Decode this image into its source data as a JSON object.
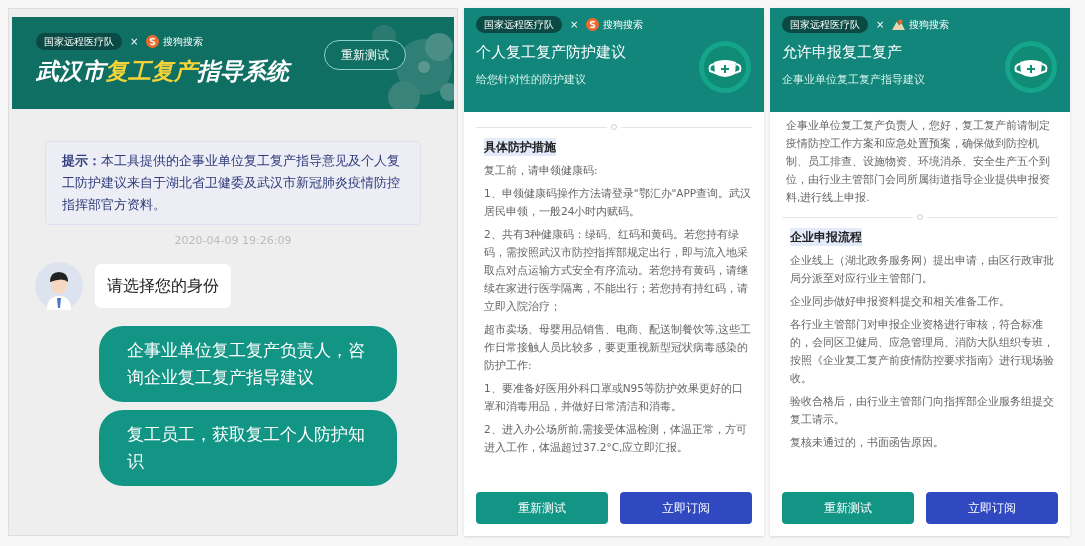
{
  "chat_panel": {
    "brand": {
      "partner": "国家远程医疗队",
      "times": "×",
      "sponsor": "搜狗搜索"
    },
    "title_parts": [
      {
        "text": "武汉市",
        "highlight": false
      },
      {
        "text": "复工复产",
        "highlight": true
      },
      {
        "text": "指导系统",
        "highlight": false
      }
    ],
    "retest_button": "重新测试",
    "notice": "**提示：**本工具提供的企事业单位复工复产指导意见及个人复工防护建议来自于湖北省卫健委及武汉市新冠肺炎疫情防控指挥部官方资料。",
    "timestamp": "2020-04-09 19:26:09",
    "bot_message": "请选择您的身份",
    "options": [
      "企事业单位复工复产负责人，咨询企业复工复产指导建议",
      "复工员工，获取复工个人防护知识"
    ]
  },
  "personal_panel": {
    "brand": {
      "partner": "国家远程医疗队",
      "times": "×",
      "sponsor": "搜狗搜索"
    },
    "title": "个人复工复产防护建议",
    "subtitle": "给您针对性的防护建议",
    "section_title": "具体防护措施",
    "paragraphs": [
      "复工前，请申领健康码:",
      "1、申领健康码操作方法请登录\"鄂汇办\"APP查询。武汉居民申领，一般24小时内赋码。",
      "2、共有3种健康码：绿码、红码和黄码。若您持有绿码，需按照武汉市防控指挥部规定出行，即与流入地采取点对点运输方式安全有序流动。若您持有黄码，请继续在家进行医学隔离，不能出行；若您持有持红码，请立即入院治疗；",
      "超市卖场、母婴用品销售、电商、配送制餐饮等,这些工作日常接触人员比较多，要更重视新型冠状病毒感染的防护工作:",
      "1、要准备好医用外科口罩或N95等防护效果更好的口罩和消毒用品，并做好日常清洁和消毒。",
      "2、进入办公场所前,需接受体温检测，体温正常，方可进入工作，体温超过37.2°C,应立即汇报。"
    ],
    "buttons": [
      "重新测试",
      "立即订阅"
    ]
  },
  "enterprise_panel": {
    "brand": {
      "partner": "国家远程医疗队",
      "times": "×",
      "sponsor": "搜狗搜索"
    },
    "title": "允许申报复工复产",
    "subtitle": "企事业单位复工复产指导建议",
    "intro": "企事业单位复工复产负责人，您好，复工复产前请制定疫情防控工作方案和应急处置预案，确保做到防控机制、员工排查、设施物资、环境消杀、安全生产五个到位，由行业主管部门会同所属街道指导企业提供申报资料,进行线上申报.",
    "section_title": "企业申报流程",
    "paragraphs": [
      "企业线上（湖北政务服务网）提出申请，由区行政审批局分派至对应行业主管部门。",
      "企业同步做好申报资料提交和相关准备工作。",
      "各行业主管部门对申报企业资格进行审核，符合标准的，会同区卫健局、应急管理局、消防大队组织专班，按照《企业复工复产前疫情防控要求指南》进行现场验收。",
      "验收合格后，由行业主管部门向指挥部企业服务组提交复工请示。",
      "复核未通过的，书面函告原因。"
    ],
    "buttons": [
      "重新测试",
      "立即订阅"
    ]
  }
}
